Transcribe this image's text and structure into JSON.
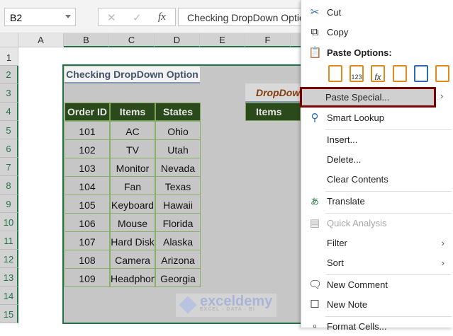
{
  "formula_bar": {
    "name_box": "B2",
    "cancel": "✕",
    "enter": "✓",
    "fx": "fx",
    "formula": "Checking DropDown Option"
  },
  "columns": [
    "A",
    "B",
    "C",
    "D",
    "E",
    "F"
  ],
  "rows": [
    "1",
    "2",
    "3",
    "4",
    "5",
    "6",
    "7",
    "8",
    "9",
    "10",
    "11",
    "12",
    "13",
    "14",
    "15"
  ],
  "sheet": {
    "title": "Checking DropDown Option",
    "headers": [
      "Order ID",
      "Items",
      "States"
    ],
    "data": [
      [
        "101",
        "AC",
        "Ohio"
      ],
      [
        "102",
        "TV",
        "Utah"
      ],
      [
        "103",
        "Monitor",
        "Nevada"
      ],
      [
        "104",
        "Fan",
        "Texas"
      ],
      [
        "105",
        "Keyboard",
        "Hawaii"
      ],
      [
        "106",
        "Mouse",
        "Florida"
      ],
      [
        "107",
        "Hard Disk",
        "Alaska"
      ],
      [
        "108",
        "Camera",
        "Arizona"
      ],
      [
        "109",
        "Headphone",
        "Georgia"
      ]
    ],
    "dropdown_title": "DropDown",
    "dropdown_header": "Items"
  },
  "watermark": {
    "name": "exceldemy",
    "tagline": "EXCEL - DATA - BI"
  },
  "menu": {
    "cut": "Cut",
    "copy": "Copy",
    "paste_options": "Paste Options:",
    "paste_icon_123": "123",
    "paste_icon_fx": "fx",
    "paste_special": "Paste Special...",
    "smart_lookup": "Smart Lookup",
    "insert": "Insert...",
    "delete": "Delete...",
    "clear_contents": "Clear Contents",
    "translate": "Translate",
    "quick_analysis": "Quick Analysis",
    "filter": "Filter",
    "sort": "Sort",
    "new_comment": "New Comment",
    "new_note": "New Note",
    "format_cells": "Format Cells..."
  }
}
